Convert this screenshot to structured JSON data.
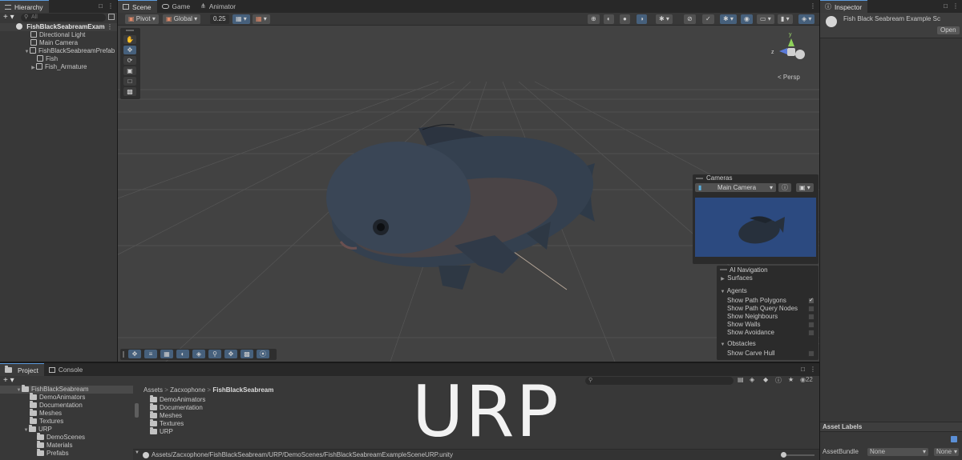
{
  "hierarchy": {
    "tab_label": "Hierarchy",
    "search_placeholder": "All",
    "items": [
      {
        "label": "FishBlackSeabreamExam"
      },
      {
        "label": "Directional Light"
      },
      {
        "label": "Main Camera"
      },
      {
        "label": "FishBlackSeabreamPrefab"
      },
      {
        "label": "Fish"
      },
      {
        "label": "Fish_Armature"
      }
    ]
  },
  "scene": {
    "tabs": [
      {
        "label": "Scene"
      },
      {
        "label": "Game"
      },
      {
        "label": "Animator"
      }
    ],
    "toolbar": {
      "pivot": "Pivot",
      "global": "Global",
      "snap_value": "0.25"
    },
    "gizmo": {
      "persp_label": "< Persp",
      "y": "y",
      "z": "z"
    }
  },
  "cameras_overlay": {
    "title": "Cameras",
    "selected_camera": "Main Camera"
  },
  "ai_navigation": {
    "title": "AI Navigation",
    "surfaces": "Surfaces",
    "agents": "Agents",
    "agent_options": [
      {
        "label": "Show Path Polygons",
        "checked": true
      },
      {
        "label": "Show Path Query Nodes",
        "checked": false
      },
      {
        "label": "Show Neighbours",
        "checked": false
      },
      {
        "label": "Show Walls",
        "checked": false
      },
      {
        "label": "Show Avoidance",
        "checked": false
      }
    ],
    "obstacles": "Obstacles",
    "obstacle_options": [
      {
        "label": "Show Carve Hull",
        "checked": false
      }
    ]
  },
  "inspector": {
    "tab_label": "Inspector",
    "title": "Fish Black Seabream Example Sc",
    "open_button": "Open",
    "asset_labels": "Asset Labels",
    "asset_bundle_label": "AssetBundle",
    "asset_bundle_value": "None",
    "asset_variant_value": "None"
  },
  "project": {
    "tabs": [
      {
        "label": "Project"
      },
      {
        "label": "Console"
      }
    ],
    "hidden_count": "22",
    "tree": [
      {
        "label": "FishBlackSeabream",
        "level": 0
      },
      {
        "label": "DemoAnimators",
        "level": 1
      },
      {
        "label": "Documentation",
        "level": 1
      },
      {
        "label": "Meshes",
        "level": 1
      },
      {
        "label": "Textures",
        "level": 1
      },
      {
        "label": "URP",
        "level": 1
      },
      {
        "label": "DemoScenes",
        "level": 2
      },
      {
        "label": "Materials",
        "level": 2
      },
      {
        "label": "Prefabs",
        "level": 2
      }
    ],
    "breadcrumb": [
      "Assets",
      "Zacxophone",
      "FishBlackSeabream"
    ],
    "breadcrumb_sep": ">",
    "folders": [
      {
        "label": "DemoAnimators"
      },
      {
        "label": "Documentation"
      },
      {
        "label": "Meshes"
      },
      {
        "label": "Textures"
      },
      {
        "label": "URP"
      }
    ],
    "status_path": "Assets/Zacxophone/FishBlackSeabream/URP/DemoScenes/FishBlackSeabreamExampleSceneURP.unity"
  },
  "overlay_text": "URP",
  "colors": {
    "accent_blue": "#46607c",
    "viewport_bg": "#424242",
    "camera_preview_bg": "#2c4a80"
  }
}
